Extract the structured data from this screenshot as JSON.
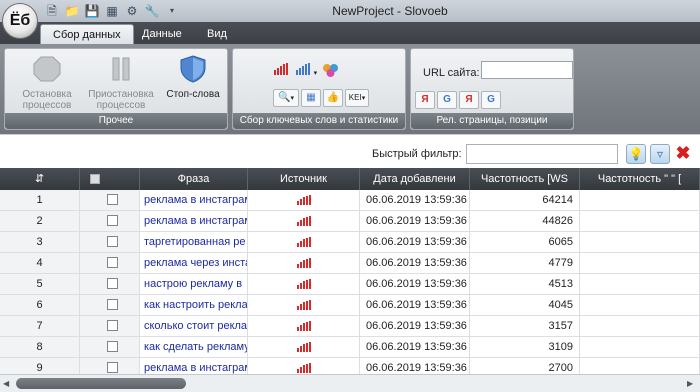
{
  "app": {
    "logo_text": "Ёб",
    "title": "NewProject - Slovoeb"
  },
  "tabs": [
    {
      "label": "Сбор данных"
    },
    {
      "label": "Данные"
    },
    {
      "label": "Вид"
    }
  ],
  "ribbon": {
    "group_misc": {
      "label": "Прочее",
      "stop_label": "Остановка процессов",
      "pause_label": "Приостановка процессов",
      "stopwords_label": "Стоп-слова"
    },
    "group_keywords": {
      "label": "Сбор ключевых слов и статистики",
      "kei_label": "KEI"
    },
    "group_url": {
      "label": "Рел. страницы, позиции",
      "url_label": "URL сайта:",
      "url_value": ""
    }
  },
  "filter": {
    "label": "Быстрый фильтр:",
    "value": ""
  },
  "grid": {
    "columns": [
      "Фраза",
      "Источник",
      "Дата добавлени",
      "Частотность [WS",
      "Частотность \" \" ["
    ],
    "rows": [
      {
        "num": "1",
        "phrase": "реклама в инстаграм",
        "date": "06.06.2019 13:59:36",
        "freq": "64214"
      },
      {
        "num": "2",
        "phrase": "реклама в инстаграм",
        "date": "06.06.2019 13:59:36",
        "freq": "44826"
      },
      {
        "num": "3",
        "phrase": "таргетированная ре",
        "date": "06.06.2019 13:59:36",
        "freq": "6065"
      },
      {
        "num": "4",
        "phrase": "реклама через инста",
        "date": "06.06.2019 13:59:36",
        "freq": "4779"
      },
      {
        "num": "5",
        "phrase": "настрою рекламу в",
        "date": "06.06.2019 13:59:36",
        "freq": "4513"
      },
      {
        "num": "6",
        "phrase": "как настроить рекла",
        "date": "06.06.2019 13:59:36",
        "freq": "4045"
      },
      {
        "num": "7",
        "phrase": "сколько стоит рекла",
        "date": "06.06.2019 13:59:36",
        "freq": "3157"
      },
      {
        "num": "8",
        "phrase": "как сделать рекламу",
        "date": "06.06.2019 13:59:36",
        "freq": "3109"
      },
      {
        "num": "9",
        "phrase": "реклама в инстаграм",
        "date": "06.06.2019 13:59:36",
        "freq": "2700"
      }
    ]
  },
  "colors": {
    "source_icon": "#d62b2b",
    "phrase_text": "#1c2aa3",
    "accent_blue": "#3f78c8"
  }
}
